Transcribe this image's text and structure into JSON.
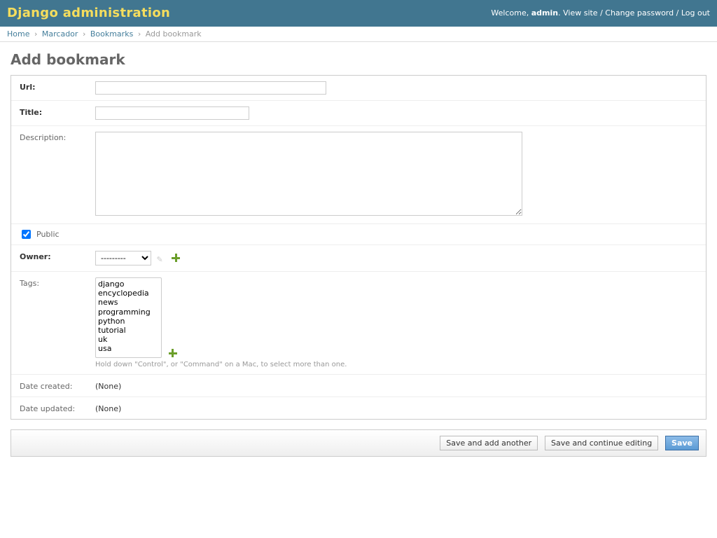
{
  "header": {
    "branding": "Django administration",
    "welcome_prefix": "Welcome, ",
    "username": "admin",
    "dot": ". ",
    "view_site": "View site",
    "change_password": "Change password",
    "log_out": "Log out",
    "sep": " / "
  },
  "breadcrumbs": {
    "home": "Home",
    "app": "Marcador",
    "model": "Bookmarks",
    "current": "Add bookmark",
    "sep": "›"
  },
  "title": "Add bookmark",
  "form": {
    "url": {
      "label": "Url:",
      "value": ""
    },
    "title_field": {
      "label": "Title:",
      "value": ""
    },
    "description": {
      "label": "Description:",
      "value": ""
    },
    "public": {
      "label": "Public",
      "checked": true
    },
    "owner": {
      "label": "Owner:",
      "selected": "---------",
      "options": [
        "---------"
      ]
    },
    "tags": {
      "label": "Tags:",
      "help": "Hold down \"Control\", or \"Command\" on a Mac, to select more than one.",
      "options": [
        "django",
        "encyclopedia",
        "news",
        "programming",
        "python",
        "tutorial",
        "uk",
        "usa"
      ]
    },
    "date_created": {
      "label": "Date created:",
      "value": "(None)"
    },
    "date_updated": {
      "label": "Date updated:",
      "value": "(None)"
    }
  },
  "buttons": {
    "save_add_another": "Save and add another",
    "save_continue": "Save and continue editing",
    "save": "Save"
  }
}
